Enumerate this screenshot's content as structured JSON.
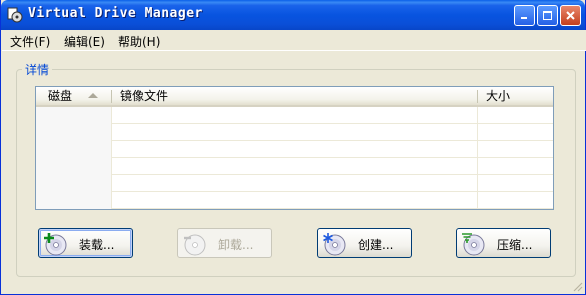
{
  "window": {
    "title": "Virtual Drive Manager"
  },
  "menu": {
    "items": [
      "文件(F)",
      "编辑(E)",
      "帮助(H)"
    ]
  },
  "group": {
    "title": "详情"
  },
  "list": {
    "columns": [
      "磁盘",
      "镜像文件",
      "大小"
    ],
    "sorted_column": "磁盘",
    "rows": []
  },
  "buttons": {
    "mount": {
      "label": "装载...",
      "icon": "disc-add-icon"
    },
    "unmount": {
      "label": "卸载...",
      "icon": "disc-eject-icon",
      "disabled": true
    },
    "create": {
      "label": "创建...",
      "icon": "disc-new-icon"
    },
    "compress": {
      "label": "压缩...",
      "icon": "disc-compress-icon"
    }
  },
  "colors": {
    "titlebar": "#0a5fe8",
    "group_title": "#0046d5",
    "window_bg": "#ece9d8"
  }
}
